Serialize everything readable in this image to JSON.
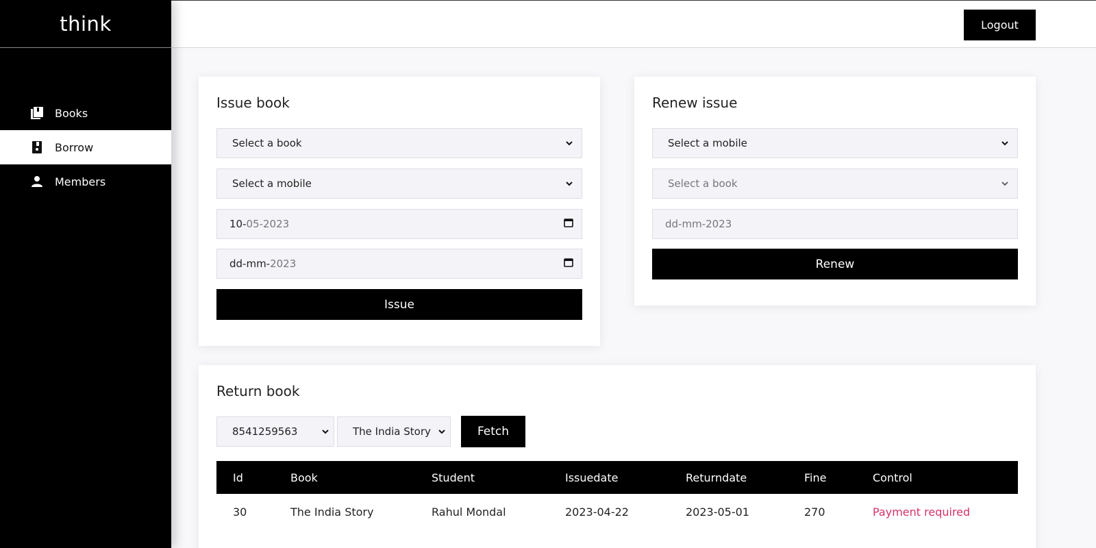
{
  "brand": "think",
  "header": {
    "logout_label": "Logout"
  },
  "sidebar": {
    "items": [
      {
        "label": "Books",
        "icon": "books-icon"
      },
      {
        "label": "Borrow",
        "icon": "borrow-icon"
      },
      {
        "label": "Members",
        "icon": "person-icon"
      }
    ],
    "active": "Borrow"
  },
  "issue": {
    "title": "Issue book",
    "book_select": "Select a book",
    "mobile_select": "Select a mobile",
    "issue_date_day": "10-",
    "issue_date_rest": "05-2023",
    "return_date_day": "dd-mm-",
    "return_date_rest": "2023",
    "button": "Issue"
  },
  "renew": {
    "title": "Renew issue",
    "mobile_select": "Select a mobile",
    "book_select": "Select a book",
    "date_placeholder": "dd-mm-2023",
    "button": "Renew"
  },
  "return_book": {
    "title": "Return book",
    "mobile_value": "8541259563",
    "book_value": "The India Story",
    "fetch_label": "Fetch",
    "columns": [
      "Id",
      "Book",
      "Student",
      "Issuedate",
      "Returndate",
      "Fine",
      "Control"
    ],
    "rows": [
      [
        "30",
        "The India Story",
        "Rahul Mondal",
        "2023-04-22",
        "2023-05-01",
        "270",
        "Payment required"
      ]
    ]
  },
  "colors": {
    "sidebar_bg": "#000000",
    "accent_button": "#000000",
    "payment_required": "#d6326b"
  }
}
